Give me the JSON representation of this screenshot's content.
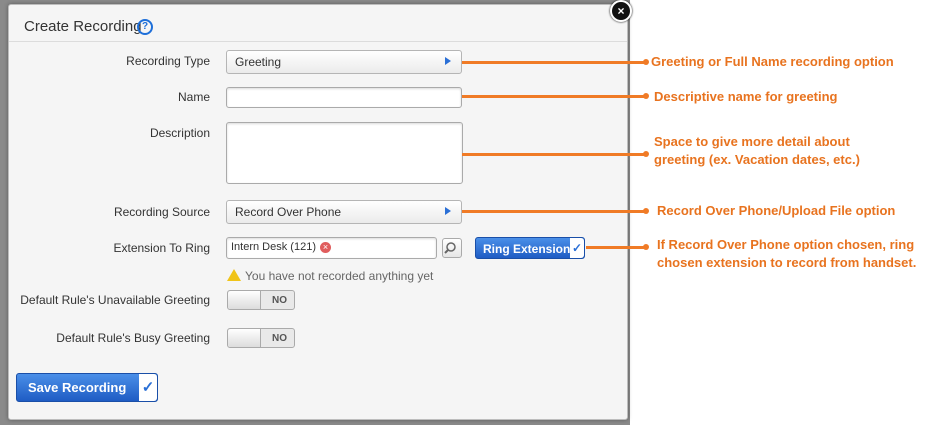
{
  "dialog": {
    "title": "Create Recording",
    "help_icon": "question-circle-icon",
    "close_icon": "close-icon"
  },
  "form": {
    "recording_type": {
      "label": "Recording Type",
      "value": "Greeting"
    },
    "name": {
      "label": "Name",
      "value": ""
    },
    "description": {
      "label": "Description",
      "value": ""
    },
    "recording_source": {
      "label": "Recording Source",
      "value": "Record Over Phone"
    },
    "extension_to_ring": {
      "label": "Extension To Ring",
      "chip": "Intern Desk (121)"
    },
    "ring_button": "Ring Extension",
    "warning": "You have not recorded anything yet",
    "unavailable_greeting": {
      "label": "Default Rule's Unavailable Greeting",
      "state": "NO"
    },
    "busy_greeting": {
      "label": "Default Rule's Busy Greeting",
      "state": "NO"
    },
    "save_button": "Save Recording"
  },
  "annotations": [
    "Greeting or Full Name recording option",
    "Descriptive name for greeting",
    "Space to give more detail about greeting (ex. Vacation dates, etc.)",
    "Record Over Phone/Upload File option",
    "If Record Over Phone option chosen, ring chosen extension to record from handset."
  ],
  "colors": {
    "accent_blue": "#2a6fd6",
    "annotation_orange": "#f07b26"
  }
}
